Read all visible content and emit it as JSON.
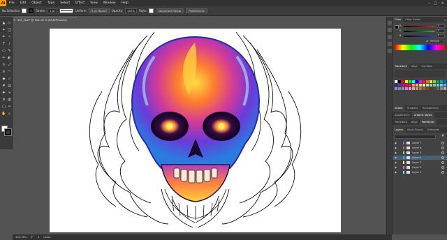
{
  "app": {
    "logo": "Ai"
  },
  "menu": [
    "File",
    "Edit",
    "Object",
    "Type",
    "Select",
    "Effect",
    "View",
    "Window",
    "Help"
  ],
  "control_bar": {
    "selection": "No Selection",
    "stroke_label": "Stroke:",
    "stroke_weight": "1 pt",
    "brush_value": "Uniform",
    "profile_value": "5 pt. Round",
    "opacity_label": "Opacity:",
    "opacity_value": "100%",
    "style_label": "Style:",
    "document_setup": "Document Setup",
    "preferences": "Preferences"
  },
  "document": {
    "tab_title": "SKT_N.ai* @ 104.16 % (RGB/Preview)",
    "close_icon": "close-icon"
  },
  "tools": [
    "selection-icon",
    "direct-selection-icon",
    "magic-wand-icon",
    "lasso-icon",
    "pen-icon",
    "curvature-icon",
    "type-icon",
    "line-icon",
    "rectangle-icon",
    "paintbrush-icon",
    "pencil-icon",
    "eraser-icon",
    "rotate-icon",
    "scale-icon",
    "width-icon",
    "warp-icon",
    "shape-builder-icon",
    "perspective-icon",
    "mesh-icon",
    "gradient-icon",
    "eyedropper-icon",
    "blend-icon",
    "symbol-sprayer-icon",
    "graph-icon",
    "artboard-icon",
    "slice-icon",
    "hand-icon",
    "zoom-icon"
  ],
  "panels": {
    "color": {
      "tabs": [
        "Color",
        "Color Guide"
      ],
      "sliders": [
        {
          "label": "R",
          "value": "0",
          "color": "#e02020"
        },
        {
          "label": "G",
          "value": "0",
          "color": "#20c020"
        },
        {
          "label": "B",
          "value": "0",
          "color": "#2040e0"
        }
      ],
      "hex_label": "#",
      "hex_value": "000000"
    },
    "transform": {
      "tabs": [
        "Transform",
        "Align",
        "Symbols"
      ]
    },
    "swatches": {
      "colors": [
        "#ffffff",
        "#000000",
        "#ff0000",
        "#ffff00",
        "#00ff00",
        "#00ffff",
        "#0000ff",
        "#ff00ff",
        "#ed1c24",
        "#f26522",
        "#fff200",
        "#8dc63f",
        "#00a651",
        "#00a99d",
        "#0072bc",
        "#2e3192",
        "#662d91",
        "#92278f",
        "#ec008c",
        "#ed145b",
        "#f7977a",
        "#fbad82",
        "#fdc68c",
        "#fff79a",
        "#c4df9b",
        "#a2d39c",
        "#82ca9d",
        "#7bcdc8",
        "#6ecff6",
        "#7ea7d8",
        "#8493ca",
        "#8882be",
        "#a187be",
        "#bc8cbf",
        "#f49ac1",
        "#f5989d",
        "#c69c6d",
        "#a67c52",
        "#8c6239",
        "#754c24",
        "#603913",
        "#464646",
        "#636363",
        "#898989",
        "#b5b5b5"
      ]
    },
    "strokes": {
      "tabs": [
        "Stroke",
        "Gradient",
        "Transparency"
      ]
    },
    "appearance": {
      "tabs": [
        "Appearance",
        "Graphic Styles"
      ]
    },
    "pathfinder": {
      "tabs": [
        "Transform",
        "Align",
        "Pathfinder"
      ]
    },
    "layers": {
      "tabs": [
        "Layers",
        "Asset Export",
        "Artboards"
      ],
      "items": [
        {
          "name": "Layer 7",
          "color": "#4f7fff",
          "selected": false
        },
        {
          "name": "Layer 6",
          "color": "#ff4f4f",
          "selected": false
        },
        {
          "name": "Layer 5",
          "color": "#4fff7f",
          "selected": false
        },
        {
          "name": "Layer 4",
          "color": "#4f9fff",
          "selected": true
        },
        {
          "name": "Layer 3",
          "color": "#ffff4f",
          "selected": false
        },
        {
          "name": "Layer 2",
          "color": "#ff4fff",
          "selected": false
        },
        {
          "name": "Layer 1",
          "color": "#4fffff",
          "selected": false
        }
      ]
    }
  },
  "status_bar": {
    "zoom": "104.16%",
    "angle": "0°",
    "artboard": "1",
    "tool": "Lasso"
  }
}
